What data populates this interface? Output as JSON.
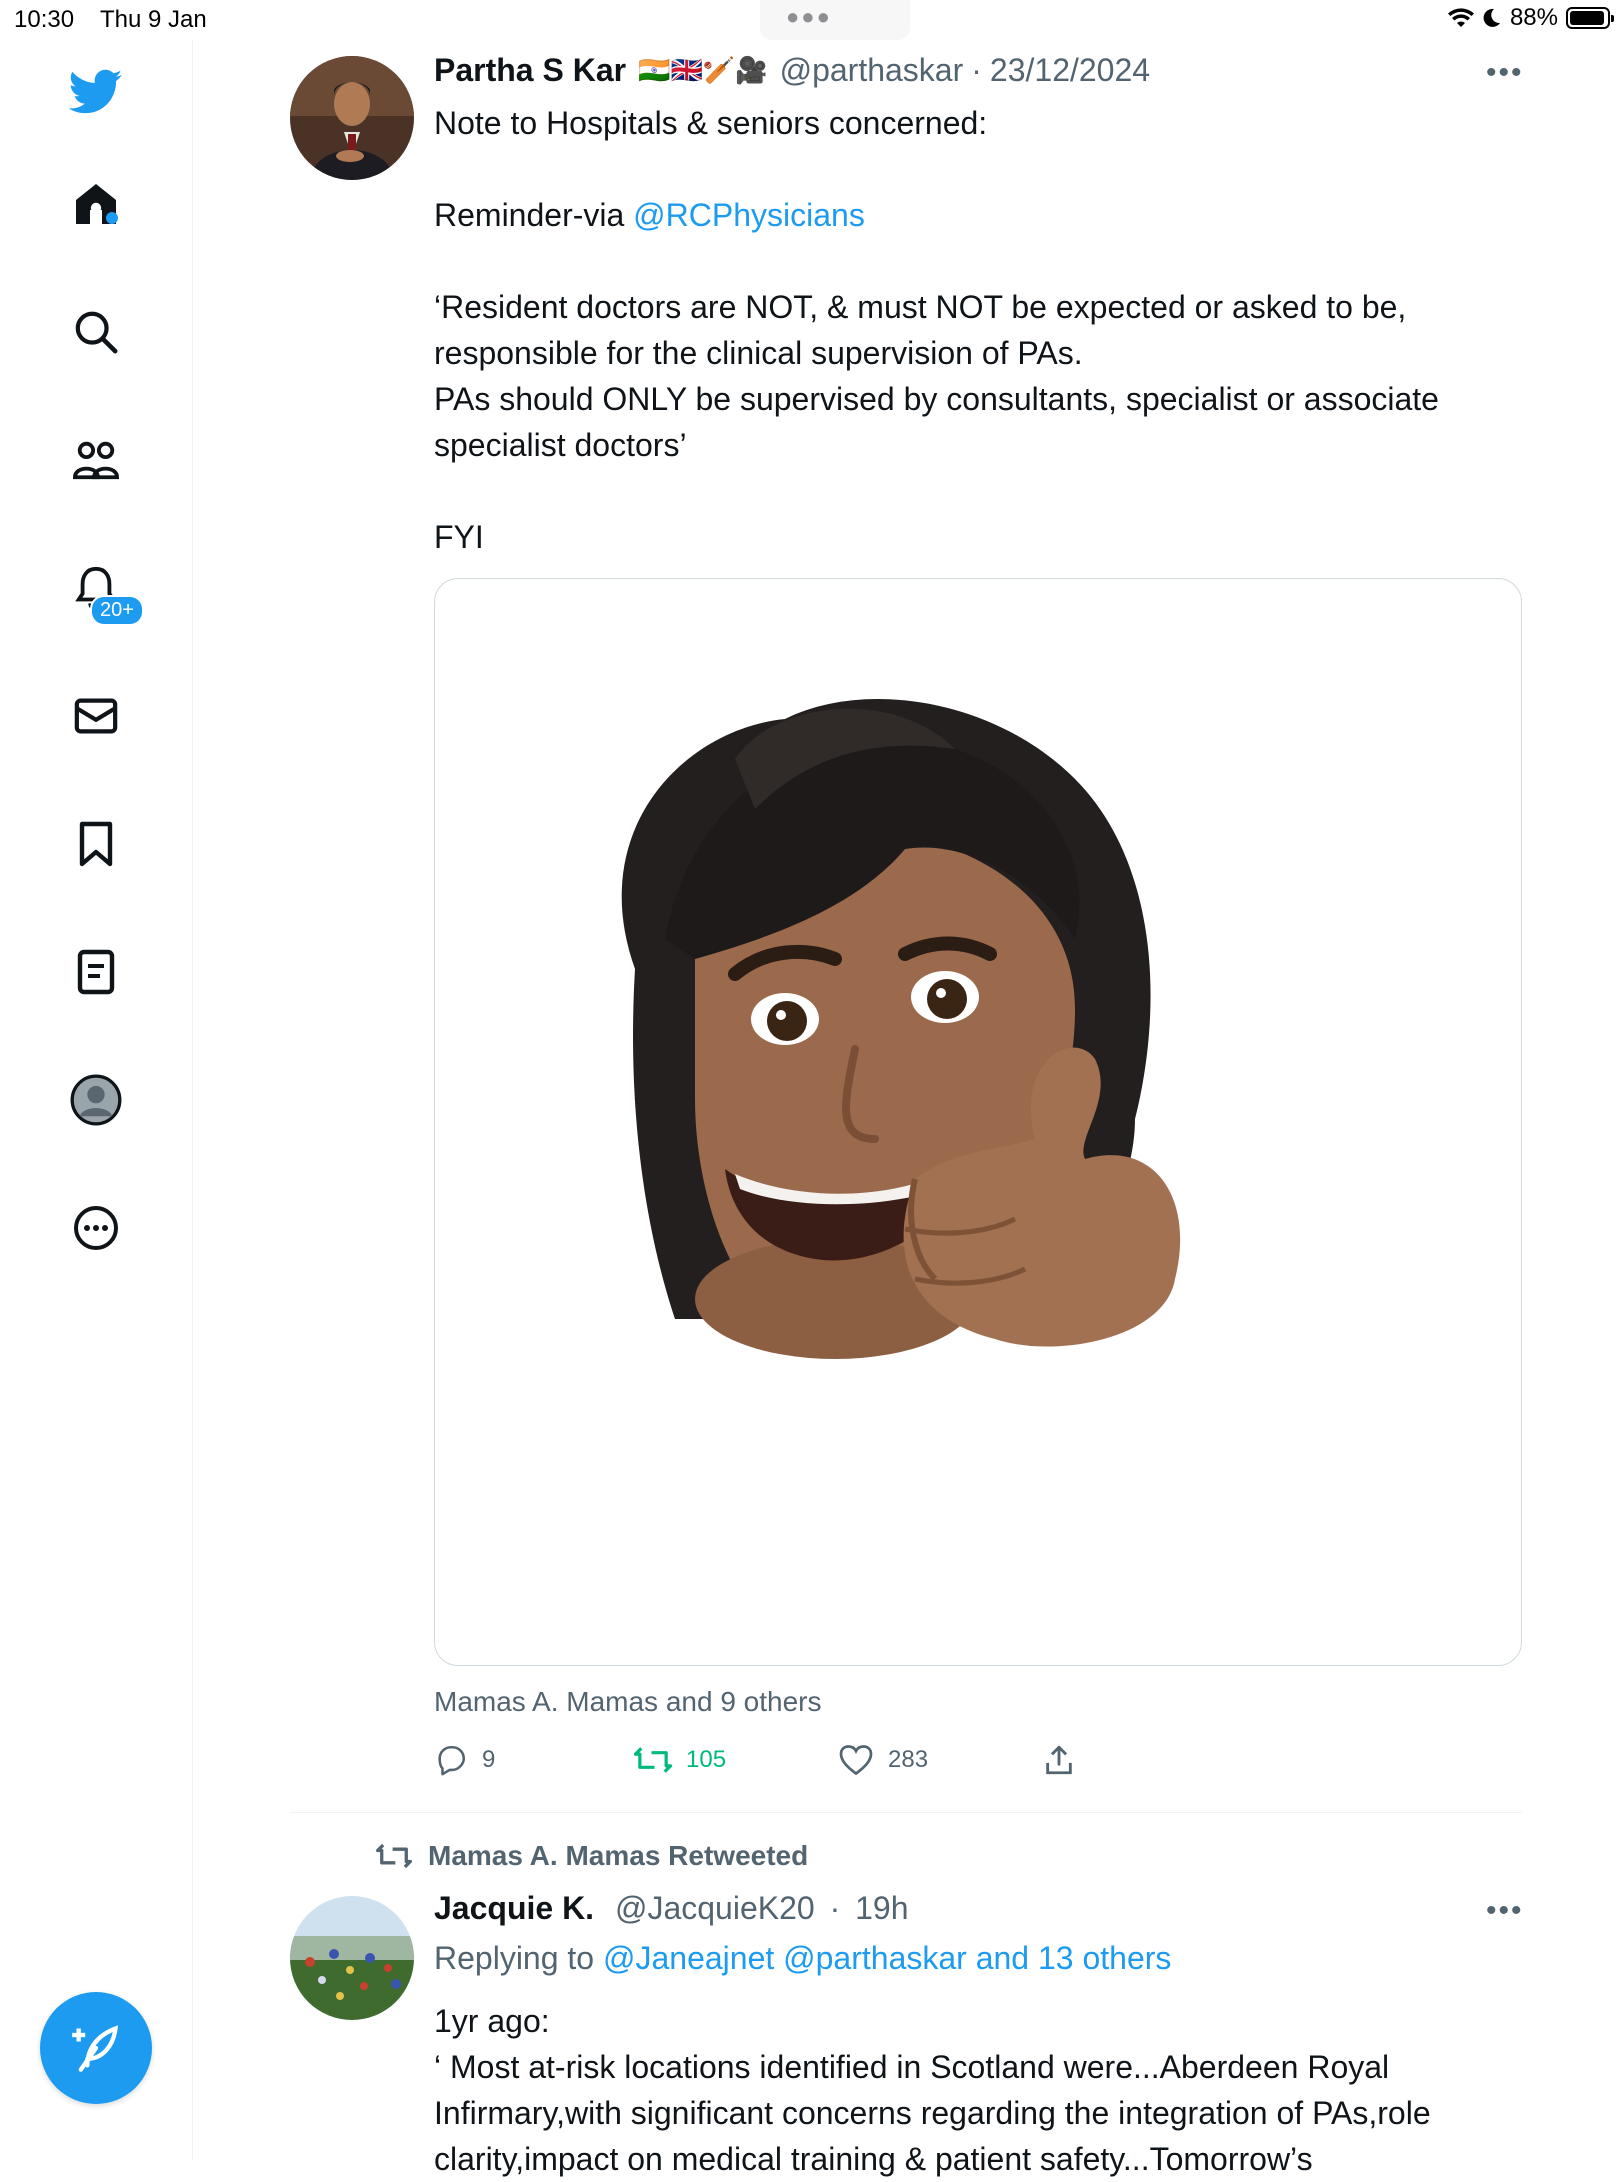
{
  "status_bar": {
    "time": "10:30",
    "date": "Thu 9 Jan",
    "battery": "88%"
  },
  "sidebar": {
    "notifications_badge": "20+",
    "items": [
      "twitter-logo",
      "home",
      "search",
      "communities",
      "notifications",
      "messages",
      "bookmarks",
      "lists",
      "profile",
      "more"
    ]
  },
  "tweet1": {
    "name": "Partha S Kar",
    "name_emojis": "🇮🇳🇬🇧🏏🎥",
    "handle": "@parthaskar",
    "separator": "·",
    "date": "23/12/2024",
    "body_line1": "Note to Hospitals & seniors concerned:",
    "body_reminder_prefix": "Reminder-via ",
    "body_reminder_link": "@RCPhysicians",
    "body_para": "‘Resident doctors are NOT, & must NOT be expected or asked to be, responsible for the clinical supervision of PAs.",
    "body_para2": "PAs should ONLY be supervised by consultants, specialist or associate specialist doctors’",
    "body_fyi": "FYI",
    "liked_by": "Mamas A. Mamas and 9 others",
    "replies": "9",
    "retweets": "105",
    "likes": "283"
  },
  "tweet2": {
    "retweeted_by": "Mamas A. Mamas Retweeted",
    "name": "Jacquie K.",
    "handle": "@JacquieK20",
    "separator": "·",
    "time": "19h",
    "replying_prefix": "Replying to ",
    "replying_targets": "@Janeajnet @parthaskar and 13 others",
    "body_line1": "1yr ago:",
    "body_line2": "‘ Most at-risk locations identified in Scotland were...Aberdeen Royal Infirmary,with significant concerns regarding the integration of PAs,role clarity,impact on medical training & patient safety...Tomorrow’s"
  },
  "colors": {
    "accent": "#1d9bf0",
    "retweet_green": "#00ba7c",
    "secondary_text": "#536471"
  }
}
